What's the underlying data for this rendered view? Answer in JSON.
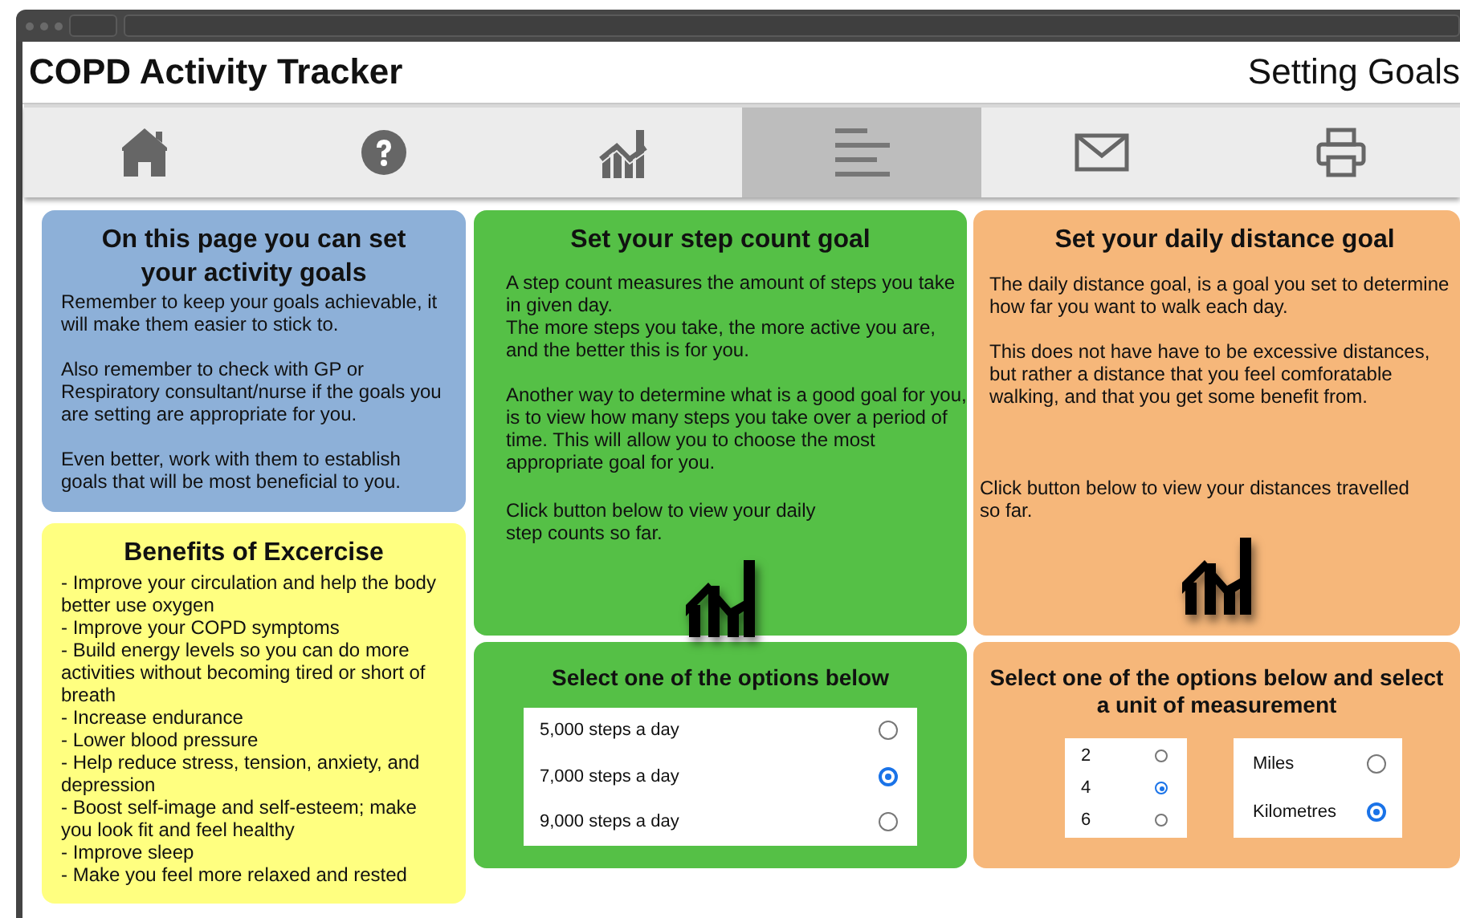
{
  "window": {
    "title": "COPD Activity Tracker",
    "page_title": "Setting Goals"
  },
  "nav_tabs": [
    {
      "kind": "home",
      "selected": false
    },
    {
      "kind": "help",
      "selected": false
    },
    {
      "kind": "chart",
      "selected": false
    },
    {
      "kind": "goals",
      "selected": true
    },
    {
      "kind": "mail",
      "selected": false
    },
    {
      "kind": "print",
      "selected": false
    }
  ],
  "intro_card": {
    "title": "On this page you can set your activity goals",
    "paragraphs": [
      [
        "Remember to keep your goals achievable, it will make them easier to stick to."
      ],
      [
        "Also remember to check with GP or Respiratory consultant/nurse if the goals you are setting are appropriate for you."
      ],
      [
        "Even better, work with them to establish goals that will be most beneficial to you."
      ]
    ]
  },
  "benefits_card": {
    "title": "Benefits of Excercise",
    "items": [
      "- Improve your circulation and help the body better use oxygen",
      "- Improve your COPD symptoms",
      "- Build energy levels so you can do more activities without becoming tired or short of breath",
      "- Increase endurance",
      "- Lower blood pressure",
      "- Help reduce stress, tension, anxiety, and depression",
      "- Boost self-image and self-esteem; make you look fit and feel healthy",
      "- Improve sleep",
      "- Make you feel more relaxed and rested"
    ]
  },
  "step_goal_card": {
    "title": "Set your step count goal",
    "paragraphs": [
      [
        "A step count measures the amount of steps you take in given day.",
        "The more steps you take, the more active you are, and the better this is for you."
      ],
      [
        "Another way to determine what is a good goal for you, is to view how many steps you take over a period of time. This will allow you to choose the most appropriate goal for you."
      ]
    ],
    "prompt": "Click button below to view your daily step counts so far."
  },
  "distance_goal_card": {
    "title": "Set your daily distance goal",
    "paragraphs": [
      [
        "The daily distance goal, is a goal you set to determine how far you want to walk each day."
      ],
      [
        "This does not have have to be excessive distances, but rather a distance that you feel comforatable walking, and that you get some benefit from."
      ]
    ],
    "prompt": "Click button below to view your distances travelled so far."
  },
  "step_options": {
    "title": "Select one of the options below",
    "options": [
      {
        "label": "5,000 steps a day",
        "selected": false
      },
      {
        "label": "7,000 steps a day",
        "selected": true
      },
      {
        "label": "9,000 steps a day",
        "selected": false
      }
    ]
  },
  "distance_options": {
    "title": "Select one of the options below and select a unit of measurement",
    "amounts": [
      {
        "label": "2",
        "selected": false
      },
      {
        "label": "4",
        "selected": true
      },
      {
        "label": "6",
        "selected": false
      }
    ],
    "units": [
      {
        "label": "Miles",
        "selected": false
      },
      {
        "label": "Kilometres",
        "selected": true
      }
    ]
  }
}
